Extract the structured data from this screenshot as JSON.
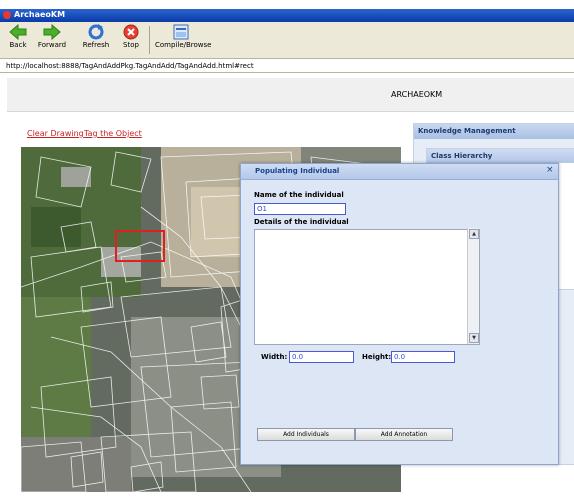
{
  "window": {
    "title": "ArchaeoKM"
  },
  "toolbar": {
    "back": "Back",
    "forward": "Forward",
    "refresh": "Refresh",
    "stop": "Stop",
    "compile": "Compile/Browse"
  },
  "address": {
    "url": "http://localhost:8888/TagAndAddPkg.TagAndAdd/TagAndAdd.html#rect"
  },
  "header": {
    "title": "ARCHAEOKM"
  },
  "links": {
    "clear": "Clear Drawing",
    "tag": "Tag the Object"
  },
  "panel": {
    "title": "Knowledge Management",
    "class_hierarchy": "Class Hierarchy"
  },
  "dialog": {
    "title": "Populating Individual",
    "close": "×",
    "name_label": "Name of the individual",
    "name_value": "O1",
    "details_label": "Details of the individual",
    "width_label": "Width:",
    "width_value": "0.0",
    "height_label": "Height:",
    "height_value": "0.0",
    "add_individuals": "Add Individuals",
    "add_annotation": "Add Annotation"
  },
  "colors": {
    "link": "#cc2222",
    "selection_rect": "#e02020",
    "title_bar": "#0a3aa8",
    "dialog_title": "#15428b"
  }
}
